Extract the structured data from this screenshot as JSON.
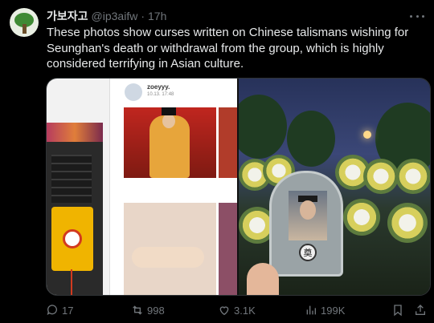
{
  "tweet": {
    "author_name": "가보자고",
    "author_handle": "@ip3aifw",
    "separator": "·",
    "time": "17h",
    "text": "These photos show curses written on Chinese talismans wishing for Seunghan's death or withdrawal from the group, which is highly considered terrifying in Asian culture."
  },
  "media": {
    "left_image": {
      "post_username": "zoeyyy.",
      "post_date": "10.13. 17:48"
    },
    "right_image": {
      "emblem_glyph": "奠"
    }
  },
  "actions": {
    "replies": "17",
    "reposts": "998",
    "likes": "3.1K",
    "views": "199K"
  },
  "colors": {
    "background": "#000000",
    "text_primary": "#e7e9ea",
    "text_secondary": "#71767b"
  },
  "icons": [
    "more-icon",
    "reply-icon",
    "repost-icon",
    "like-icon",
    "views-icon",
    "bookmark-icon",
    "share-icon"
  ]
}
